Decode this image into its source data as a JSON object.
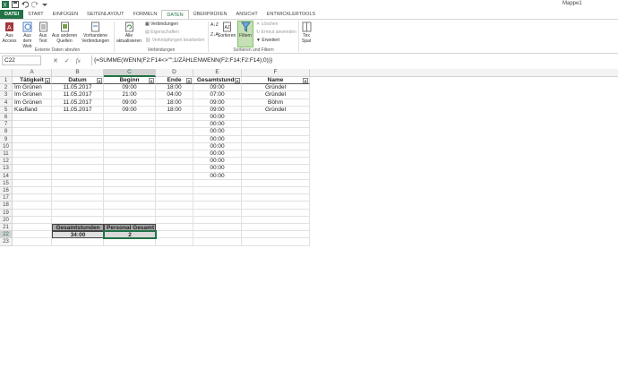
{
  "window": {
    "title": "Mappe1"
  },
  "tabs": [
    "DATEI",
    "START",
    "EINFÜGEN",
    "SEITENLAYOUT",
    "FORMELN",
    "DATEN",
    "ÜBERPRÜFEN",
    "ANSICHT",
    "ENTWICKLERTOOLS"
  ],
  "ribbon": {
    "ext_data": {
      "label": "Externe Daten abrufen",
      "buttons": [
        "Aus Access",
        "Aus dem Web",
        "Aus Text",
        "Aus anderen Quellen",
        "Vorhandene Verbindungen"
      ]
    },
    "connections": {
      "label": "Verbindungen",
      "refresh": "Alle aktualisieren",
      "items": [
        "Verbindungen",
        "Eigenschaften",
        "Verknüpfungen bearbeiten"
      ]
    },
    "sort_filter": {
      "label": "Sortieren und Filtern",
      "sort": "Sortieren",
      "filter": "Filtern",
      "items": [
        "Löschen",
        "Erneut anwenden",
        "Erweitert"
      ],
      "more": "Tex Spal"
    }
  },
  "formula_bar": {
    "name_box": "C22",
    "fx": "fx",
    "formula": "{=SUMME(WENN(F2:F14<>\"\";1/ZÄHLENWENN(F2:F14;F2:F14);0))}"
  },
  "sheet": {
    "columns": [
      "A",
      "B",
      "C",
      "D",
      "E",
      "F"
    ],
    "selected_column": "C",
    "selected_row": 22,
    "row_numbers": [
      "1",
      "2",
      "3",
      "4",
      "5",
      "6",
      "7",
      "8",
      "9",
      "10",
      "11",
      "12",
      "13",
      "14",
      "15",
      "16",
      "17",
      "18",
      "19",
      "20",
      "21",
      "22",
      "23"
    ],
    "headers": [
      "Tätigkeit",
      "Datum",
      "Beginn",
      "Ende",
      "Gesamtstunde",
      "Name"
    ],
    "rows": [
      [
        "Im Grünen",
        "11.05.2017",
        "09:00",
        "18:00",
        "09:00",
        "Gründel"
      ],
      [
        "Im Grünen",
        "11.05.2017",
        "21:00",
        "04:00",
        "07:00",
        "Gründel"
      ],
      [
        "Im Grünen",
        "11.05.2017",
        "09:00",
        "18:00",
        "09:00",
        "Böhm"
      ],
      [
        "Kaufland",
        "11.05.2017",
        "09:00",
        "18:00",
        "09:00",
        "Gründel"
      ]
    ],
    "empty_totals": [
      "00:00",
      "00:00",
      "00:00",
      "00:00",
      "00:00",
      "00:00",
      "00:00",
      "00:00",
      "00:00"
    ],
    "summary": {
      "label_total_hours": "Gesamtstunden",
      "label_total_staff": "Personal Gesamt",
      "total_hours": "34:00",
      "total_staff": "2"
    }
  }
}
